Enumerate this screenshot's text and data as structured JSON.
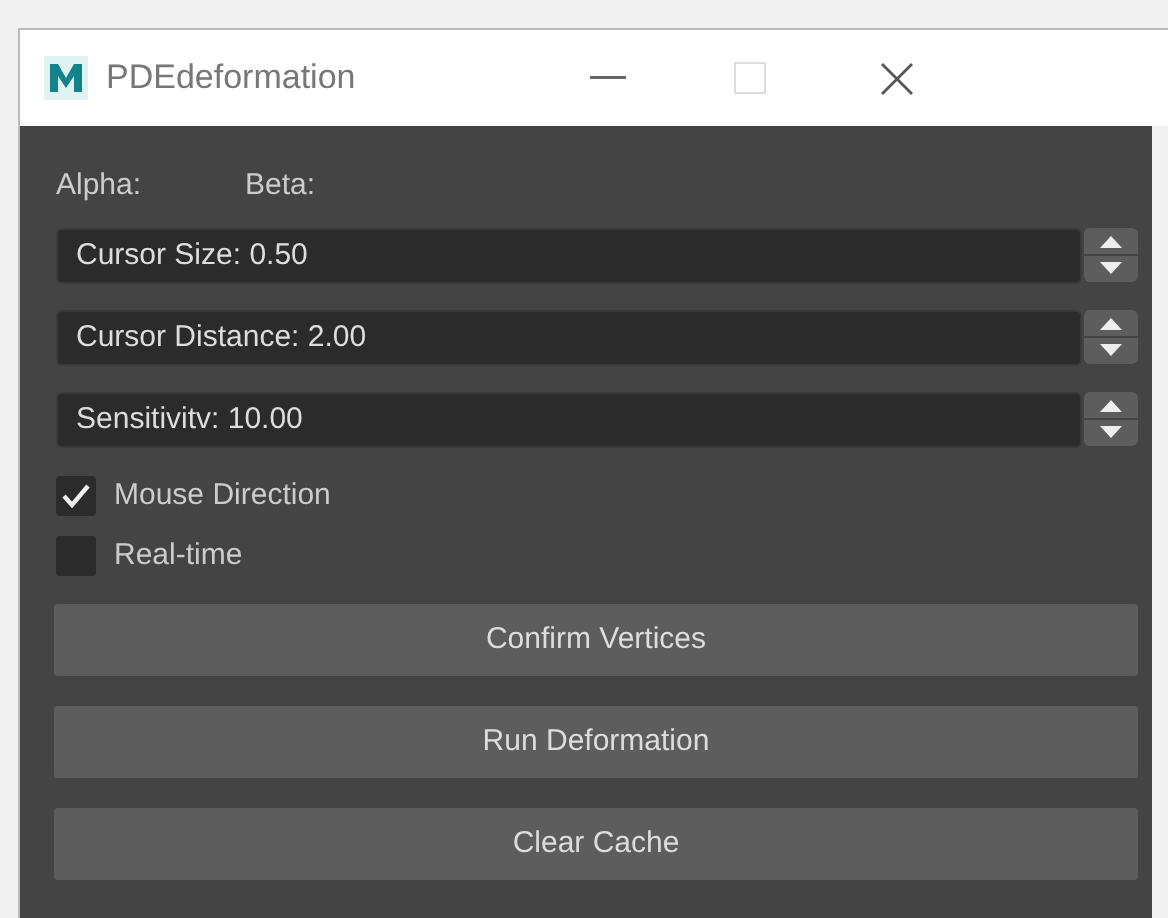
{
  "window": {
    "title": "PDEdeformation"
  },
  "labels": [
    "Alpha:",
    "Beta:"
  ],
  "spinboxes": [
    {
      "value": "Cursor Size: 0.50"
    },
    {
      "value": "Cursor Distance: 2.00"
    },
    {
      "value": "Sensitivitv: 10.00"
    }
  ],
  "checkboxes": [
    {
      "label": "Mouse Direction",
      "checked": true
    },
    {
      "label": "Real-time",
      "checked": false
    }
  ],
  "buttons": [
    "Confirm Vertices",
    "Run Deformation",
    "Clear Cache"
  ]
}
